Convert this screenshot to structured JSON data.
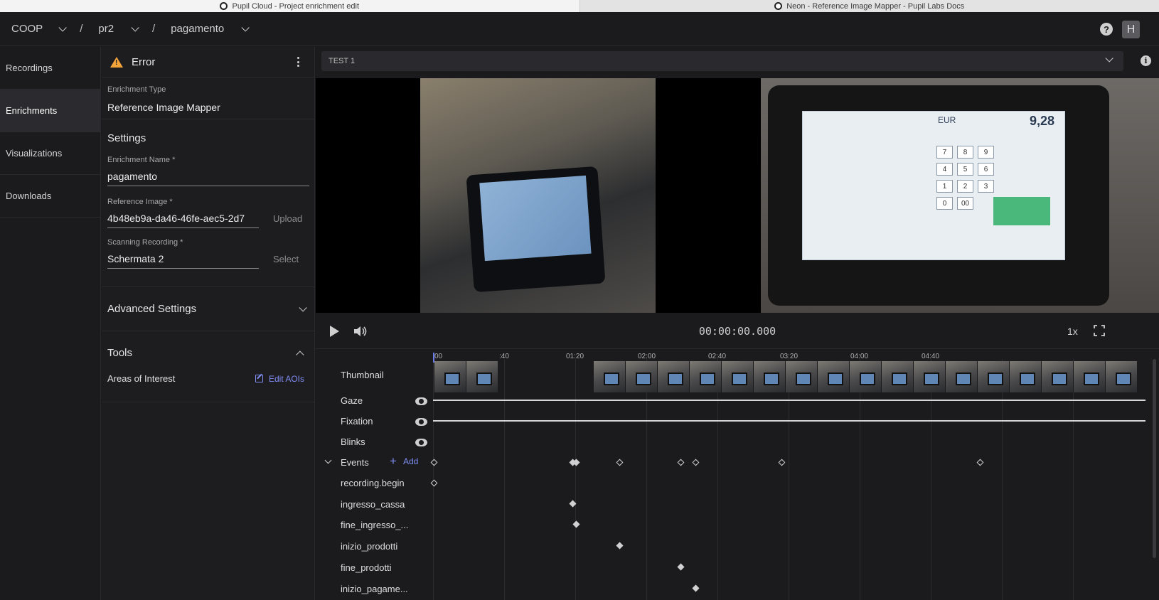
{
  "browser_tabs": [
    {
      "title": "Pupil Cloud - Project enrichment edit",
      "active": true
    },
    {
      "title": "Neon - Reference Image Mapper - Pupil Labs Docs",
      "active": false
    }
  ],
  "breadcrumb": {
    "workspace": "COOP",
    "project": "pr2",
    "enrichment": "pagamento",
    "separator": "/"
  },
  "header": {
    "help_icon": "?",
    "avatar_initial": "H"
  },
  "nav": {
    "items": [
      {
        "label": "Recordings",
        "active": false
      },
      {
        "label": "Enrichments",
        "active": true
      },
      {
        "label": "Visualizations",
        "active": false
      },
      {
        "label": "Downloads",
        "active": false
      }
    ]
  },
  "panel": {
    "status": "Error",
    "enrichment_type_label": "Enrichment Type",
    "enrichment_type_value": "Reference Image Mapper",
    "settings_heading": "Settings",
    "name_label": "Enrichment Name *",
    "name_value": "pagamento",
    "reference_label": "Reference Image *",
    "reference_value": "4b48eb9a-da46-46fe-aec5-2d7",
    "upload_label": "Upload",
    "scanning_label": "Scanning Recording *",
    "scanning_value": "Schermata 2",
    "select_label": "Select",
    "advanced_heading": "Advanced Settings",
    "tools_heading": "Tools",
    "aoi_label": "Areas of Interest",
    "edit_aoi_label": "Edit AOIs"
  },
  "main": {
    "recording_select": "TEST 1",
    "info_icon": "i",
    "timecode": "00:00:00.000",
    "speed": "1x",
    "pos": {
      "currency": "EUR",
      "amount": "9,28",
      "keys": [
        "7",
        "8",
        "9",
        "4",
        "5",
        "6",
        "1",
        "2",
        "3",
        "0",
        "00",
        ""
      ]
    }
  },
  "timeline": {
    "ticks": [
      "00",
      ":40",
      "01:20",
      "02:00",
      "02:40",
      "03:20",
      "04:00",
      "04:40"
    ],
    "rows": {
      "thumbnail": "Thumbnail",
      "gaze": "Gaze",
      "fixation": "Fixation",
      "blinks": "Blinks",
      "events": "Events",
      "add": "Add"
    },
    "events": [
      {
        "label": "recording.begin"
      },
      {
        "label": "ingresso_cassa"
      },
      {
        "label": "fine_ingresso_..."
      },
      {
        "label": "inizio_prodotti"
      },
      {
        "label": "fine_prodotti"
      },
      {
        "label": "inizio_pagame..."
      }
    ]
  },
  "colors": {
    "accent": "#7f8df2",
    "warning": "#f2a33a",
    "background": "#1b1b1e"
  }
}
